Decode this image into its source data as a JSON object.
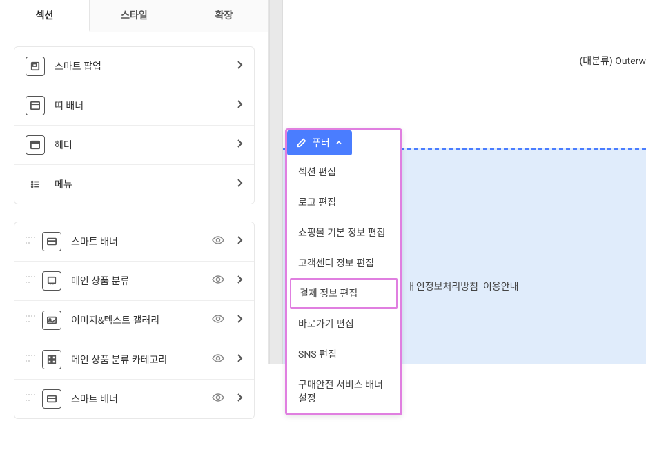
{
  "tabs": {
    "section": "섹션",
    "style": "스타일",
    "extend": "확장"
  },
  "fixed_items": [
    {
      "label": "스마트 팝업"
    },
    {
      "label": "띠 배너"
    },
    {
      "label": "헤더"
    },
    {
      "label": "메뉴"
    }
  ],
  "list_items": [
    {
      "label": "스마트 배너"
    },
    {
      "label": "메인 상품 분류"
    },
    {
      "label": "이미지&텍스트 갤러리"
    },
    {
      "label": "메인 상품 분류 카테고리"
    },
    {
      "label": "스마트 배너"
    }
  ],
  "breadcrumb": "(대분류) Outerw",
  "context_menu": {
    "header": "푸터",
    "items": [
      "섹션 편집",
      "로고 편집",
      "쇼핑몰 기본 정보 편집",
      "고객센터 정보 편집",
      "결제 정보 편집",
      "바로가기 편집",
      "SNS 편집",
      "구매안전 서비스 배너 설정"
    ]
  },
  "footer_links": {
    "privacy": "ㅐ인정보처리방침",
    "terms": "이용안내"
  }
}
